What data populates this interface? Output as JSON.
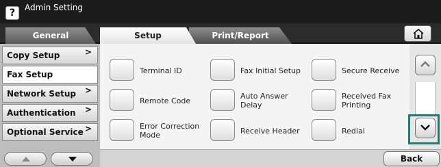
{
  "title_bar": {
    "help_label": "?",
    "title": "Admin Setting"
  },
  "tabs": [
    {
      "label": "General",
      "active": false
    },
    {
      "label": "Setup",
      "active": true
    },
    {
      "label": "Print/Report",
      "active": false
    }
  ],
  "home_button_icon": "home-icon",
  "left_menu": {
    "items": [
      {
        "label": "Copy Setup",
        "has_submenu": true,
        "selected": false
      },
      {
        "label": "Fax Setup",
        "has_submenu": false,
        "selected": true
      },
      {
        "label": "Network Setup",
        "has_submenu": true,
        "selected": false
      },
      {
        "label": "Authentication",
        "has_submenu": true,
        "selected": false
      },
      {
        "label": "Optional Service",
        "has_submenu": true,
        "selected": false
      }
    ],
    "chevron": ">"
  },
  "options": [
    {
      "label": "Terminal ID"
    },
    {
      "label": "Fax Initial Setup"
    },
    {
      "label": "Secure Receive"
    },
    {
      "label": "Remote Code"
    },
    {
      "label": "Auto Answer Delay"
    },
    {
      "label": "Received Fax Printing"
    },
    {
      "label": "Error Correction Mode"
    },
    {
      "label": "Receive Header"
    },
    {
      "label": "Redial"
    }
  ],
  "bottom": {
    "back_label": "Back"
  },
  "colors": {
    "highlight": "#1f7a74",
    "title_bar": "#1c1c1c"
  }
}
